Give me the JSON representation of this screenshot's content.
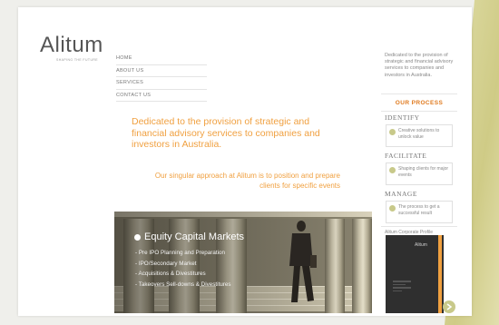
{
  "brand": {
    "logo_text": "Alitum",
    "tagline": "SHAPING THE FUTURE"
  },
  "nav": {
    "items": [
      {
        "label": "HOME"
      },
      {
        "label": "ABOUT US"
      },
      {
        "label": "SERVICES"
      },
      {
        "label": "CONTACT US"
      }
    ]
  },
  "main": {
    "headline": "Dedicated to the provision of strategic and financial advisory services to companies and investors in Australia.",
    "subhead": "Our singular approach at Alitum is to position and prepare clients for specific events"
  },
  "hero": {
    "title": "Equity Capital Markets",
    "items": [
      {
        "label": "- Pre IPO Planning and Preparation"
      },
      {
        "label": "- IPO/Secondary Market"
      },
      {
        "label": "- Acquisitions & Divestitures"
      },
      {
        "label": "- Takeovers Sell-downs & Divestitures"
      }
    ]
  },
  "sidebar": {
    "intro": "Dedicated to the provision of strategic and financial advisory services to companies and investors in Australia.",
    "process_title": "OUR PROCESS",
    "stages": [
      {
        "label": "IDENTIFY",
        "text": "Creative solutions to unlock value"
      },
      {
        "label": "FACILITATE",
        "text": "Shaping clients for major events"
      },
      {
        "label": "MANAGE",
        "text": "The process to get a successful result"
      }
    ],
    "corporate_profile": "Alitum Corporate Profile",
    "brochure_logo": "Alitum"
  },
  "colors": {
    "accent_orange": "#f0a040",
    "olive": "#c8c98a",
    "process_orange": "#e07b20"
  },
  "icons": {
    "bullet": "circle-bullet-icon",
    "next": "arrow-right-icon"
  }
}
